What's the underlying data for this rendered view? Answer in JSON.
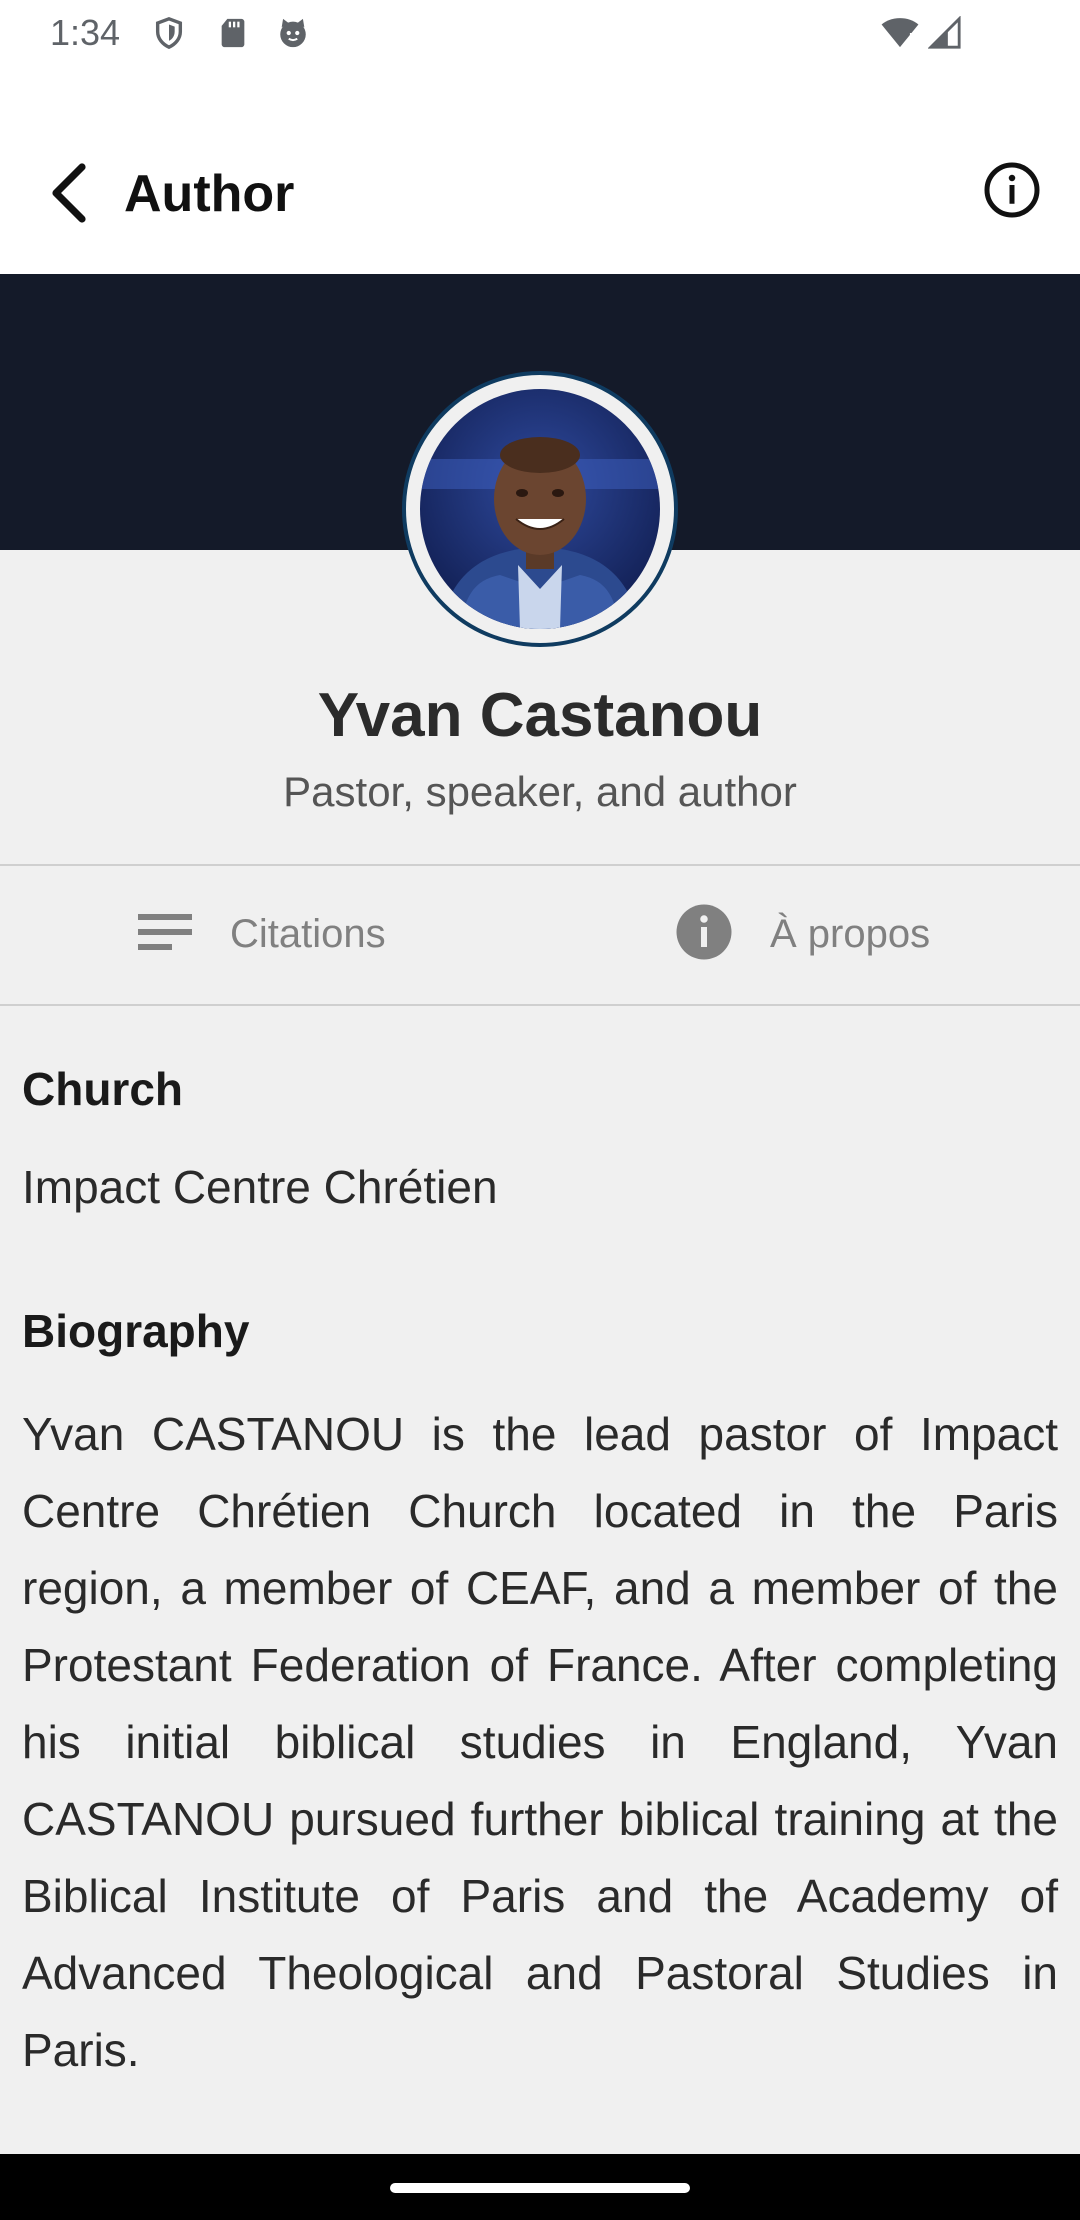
{
  "status_bar": {
    "time": "1:34",
    "icons": [
      "shield-icon",
      "sd-card-icon",
      "cat-face-icon",
      "wifi-icon",
      "signal-icon"
    ]
  },
  "app_bar": {
    "title": "Author",
    "back_icon": "chevron-left-icon",
    "info_icon": "info-outline-icon"
  },
  "profile": {
    "name": "Yvan Castanou",
    "subtitle": "Pastor, speaker, and author",
    "banner_color": "#141a29",
    "avatar_ring_color": "#0f3b60"
  },
  "tabs": [
    {
      "label": "Citations",
      "icon": "list-lines-icon"
    },
    {
      "label": "À propos",
      "icon": "info-filled-icon"
    }
  ],
  "about": {
    "church_heading": "Church",
    "church_value": "Impact Centre Chrétien",
    "biography_heading": "Biography",
    "biography_text": "Yvan CASTANOU is the lead pastor of Impact Centre Chrétien Church located in the Paris region, a member of CEAF, and a member of the Protestant Federation of France. After completing his initial biblical studies in England, Yvan CASTANOU pursued further biblical training at the Biblical Institute of Paris and the Academy of Advanced Theological and Pastoral Studies in Paris."
  }
}
